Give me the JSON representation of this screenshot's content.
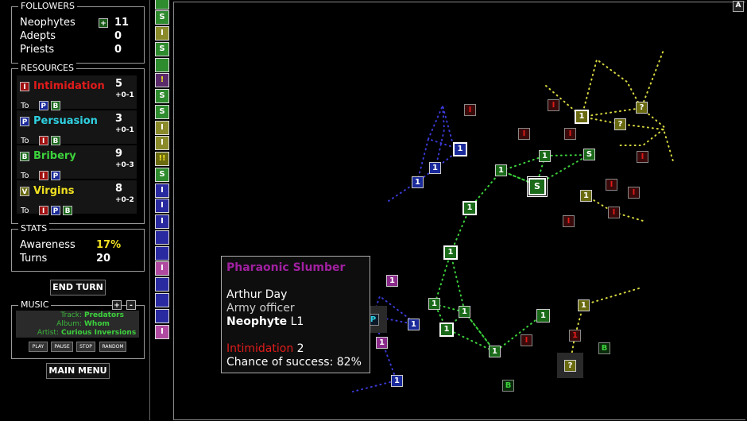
{
  "followers": {
    "title": "FOLLOWERS",
    "plus": "+",
    "rows": [
      {
        "label": "Neophytes",
        "value": "11"
      },
      {
        "label": "Adepts",
        "value": "0"
      },
      {
        "label": "Priests",
        "value": "0"
      }
    ]
  },
  "resources": {
    "title": "RESOURCES",
    "to_label": "To",
    "items": [
      {
        "letter": "I",
        "name": "Intimidation",
        "value": "5",
        "delta": "+0-1",
        "color": "#e11b1b",
        "to": [
          "P",
          "B"
        ]
      },
      {
        "letter": "P",
        "name": "Persuasion",
        "value": "3",
        "delta": "+0-1",
        "color": "#2fd0e0",
        "to": [
          "I",
          "B"
        ]
      },
      {
        "letter": "B",
        "name": "Bribery",
        "value": "9",
        "delta": "+0-3",
        "color": "#3cd23c",
        "to": [
          "I",
          "P"
        ]
      },
      {
        "letter": "V",
        "name": "Virgins",
        "value": "8",
        "delta": "+0-2",
        "color": "#f0e020",
        "to": [
          "I",
          "P",
          "B"
        ]
      }
    ]
  },
  "stats": {
    "title": "STATS",
    "awareness_label": "Awareness",
    "awareness_value": "17%",
    "turns_label": "Turns",
    "turns_value": "20"
  },
  "end_turn": "END TURN",
  "music": {
    "title": "MUSIC",
    "plus": "+",
    "minus": "-",
    "track_label": "Track:",
    "track": "Predators",
    "album_label": "Album:",
    "album": "Whom",
    "artist_label": "Artist:",
    "artist": "Curious Inversions",
    "buttons": [
      "PLAY",
      "PAUSE",
      "STOP",
      "RANDOM"
    ]
  },
  "main_menu": "MAIN MENU",
  "corner_label": "A",
  "strip": [
    "S",
    "I",
    "S",
    "",
    "!",
    "S",
    "S",
    "I",
    "I",
    "!!",
    "S",
    "I",
    "I",
    "I",
    "",
    "",
    "I",
    "",
    "",
    "",
    "I"
  ],
  "tooltip": {
    "title": "Pharaonic Slumber",
    "name": "Arthur Day",
    "job": "Army officer",
    "rank": "Neophyte",
    "level": "L1",
    "resource": "Intimidation",
    "amount": "2",
    "chance_label": "Chance of success:",
    "chance": "82%"
  },
  "colors": {
    "intimidation": "#e11b1b",
    "persuasion": "#2fd0e0",
    "bribery": "#3cd23c",
    "virgins": "#f0e020",
    "tooltip_title": "#a020a0",
    "awareness": "#f0e020"
  },
  "map_nodes": [
    "1",
    "1",
    "1",
    "1",
    "1",
    "1",
    "1",
    "1",
    "1",
    "1",
    "1",
    "1",
    "1",
    "1",
    "1",
    "1",
    "1",
    "1",
    "1",
    "1",
    "S",
    "S",
    "?",
    "?",
    "?",
    "I",
    "I",
    "I",
    "I",
    "I",
    "I",
    "I",
    "I",
    "I",
    "I",
    "B",
    "B",
    "P"
  ]
}
